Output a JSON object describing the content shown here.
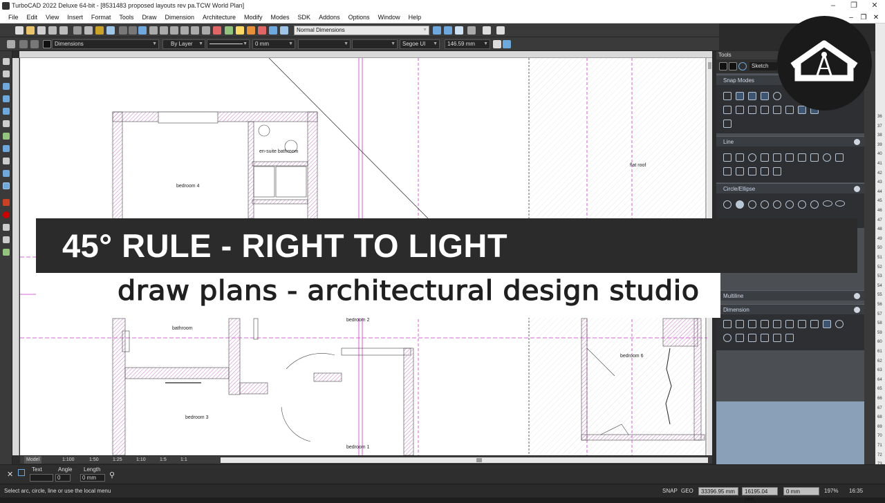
{
  "window": {
    "title": "TurboCAD 2022 Deluxe 64-bit - [8531483 proposed layouts rev pa.TCW World Plan]",
    "controls": [
      "–",
      "❐",
      "✕"
    ],
    "mdi_controls": [
      "–",
      "❐",
      "✕"
    ]
  },
  "menu": [
    "File",
    "Edit",
    "View",
    "Insert",
    "Format",
    "Tools",
    "Draw",
    "Dimension",
    "Architecture",
    "Modify",
    "Modes",
    "SDK",
    "Addons",
    "Options",
    "Window",
    "Help"
  ],
  "toolbar": {
    "dim_style": "Normal Dimensions",
    "layer": "Dimensions",
    "color": "By Layer",
    "thickness": "0 mm",
    "font": "Segoe UI",
    "text_height": "146.59 mm"
  },
  "drawing": {
    "rooms": [
      "en-suite bathroom",
      "bedroom 4",
      "flat roof",
      "bathroom",
      "bedroom 2",
      "bedroom 3",
      "bedroom 6",
      "bedroom 1"
    ]
  },
  "tabs": [
    "Model",
    "1:100",
    "1:50",
    "1:25",
    "1:10",
    "1:5",
    "1:1"
  ],
  "inspector": {
    "text_label": "Text",
    "angle_label": "Angle",
    "angle_value": "0",
    "length_label": "Length",
    "length_value": "0 mm"
  },
  "status": {
    "message": "Select arc, circle, line or use the local menu",
    "snap": "SNAP",
    "geo": "GEO",
    "x": "33396.95 mm",
    "y": "16195.04 mm",
    "z": "0 mm",
    "zoom": "197%",
    "time": "16:35"
  },
  "tools_panel": {
    "header": "Tools",
    "mode": "Sketch",
    "sections": [
      "Snap Modes",
      "Line",
      "Circle/Ellipse",
      "Multiline",
      "Dimension"
    ]
  },
  "side_ruler": [
    "36",
    "37",
    "38",
    "39",
    "40",
    "41",
    "42",
    "43",
    "44",
    "45",
    "46",
    "47",
    "48",
    "49",
    "50",
    "51",
    "52",
    "53",
    "54",
    "55",
    "56",
    "57",
    "58",
    "59",
    "60",
    "61",
    "62",
    "63",
    "64",
    "65",
    "66",
    "67",
    "68",
    "69",
    "70",
    "71",
    "72",
    "73"
  ],
  "overlay": {
    "headline": "45° RULE - RIGHT TO LIGHT",
    "subtitle": "draw plans - architectural design studio"
  },
  "colors": {
    "wall_hatch": "#d27bd2",
    "guide_line": "#cc33cc",
    "banner_bg": "#2b2b2b",
    "panel_bg": "#2d2f32",
    "panel_empty": "#8aa0b9"
  },
  "icons": {
    "logo": "house-drawing-compass-logo"
  }
}
